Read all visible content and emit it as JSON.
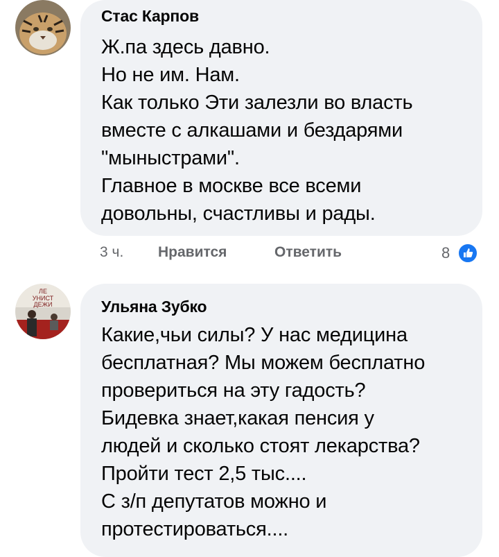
{
  "comments": [
    {
      "author": "Стас Карпов",
      "avatar_icon": "tiger-avatar-icon",
      "lines": [
        "Ж.па здесь давно.",
        "Но не им. Нам.",
        "Как только Эти залезли во власть",
        "вместе с алкашами и бездарями",
        "\"мыныстрами\".",
        "Главное в москве все всеми",
        "довольны, счастливы и рады."
      ],
      "time": "3 ч.",
      "like_label": "Нравится",
      "reply_label": "Ответить",
      "reaction_count": "8",
      "reaction_icon": "like-icon"
    },
    {
      "author": "Ульяна Зубко",
      "avatar_icon": "person-avatar-icon",
      "lines": [
        "Какие,чьи силы? У нас медицина",
        "бесплатная? Мы можем бесплатно",
        "провериться на эту гадость?",
        "Бидевка знает,какая пенсия у",
        "людей и сколько стоят лекарства?",
        "Пройти тест 2,5 тыс....",
        "С з/п депутатов можно и",
        "протестироваться...."
      ]
    }
  ],
  "colors": {
    "bubble": "#f0f2f5",
    "text": "#050505",
    "meta": "#65676b",
    "like": "#1877f2"
  }
}
